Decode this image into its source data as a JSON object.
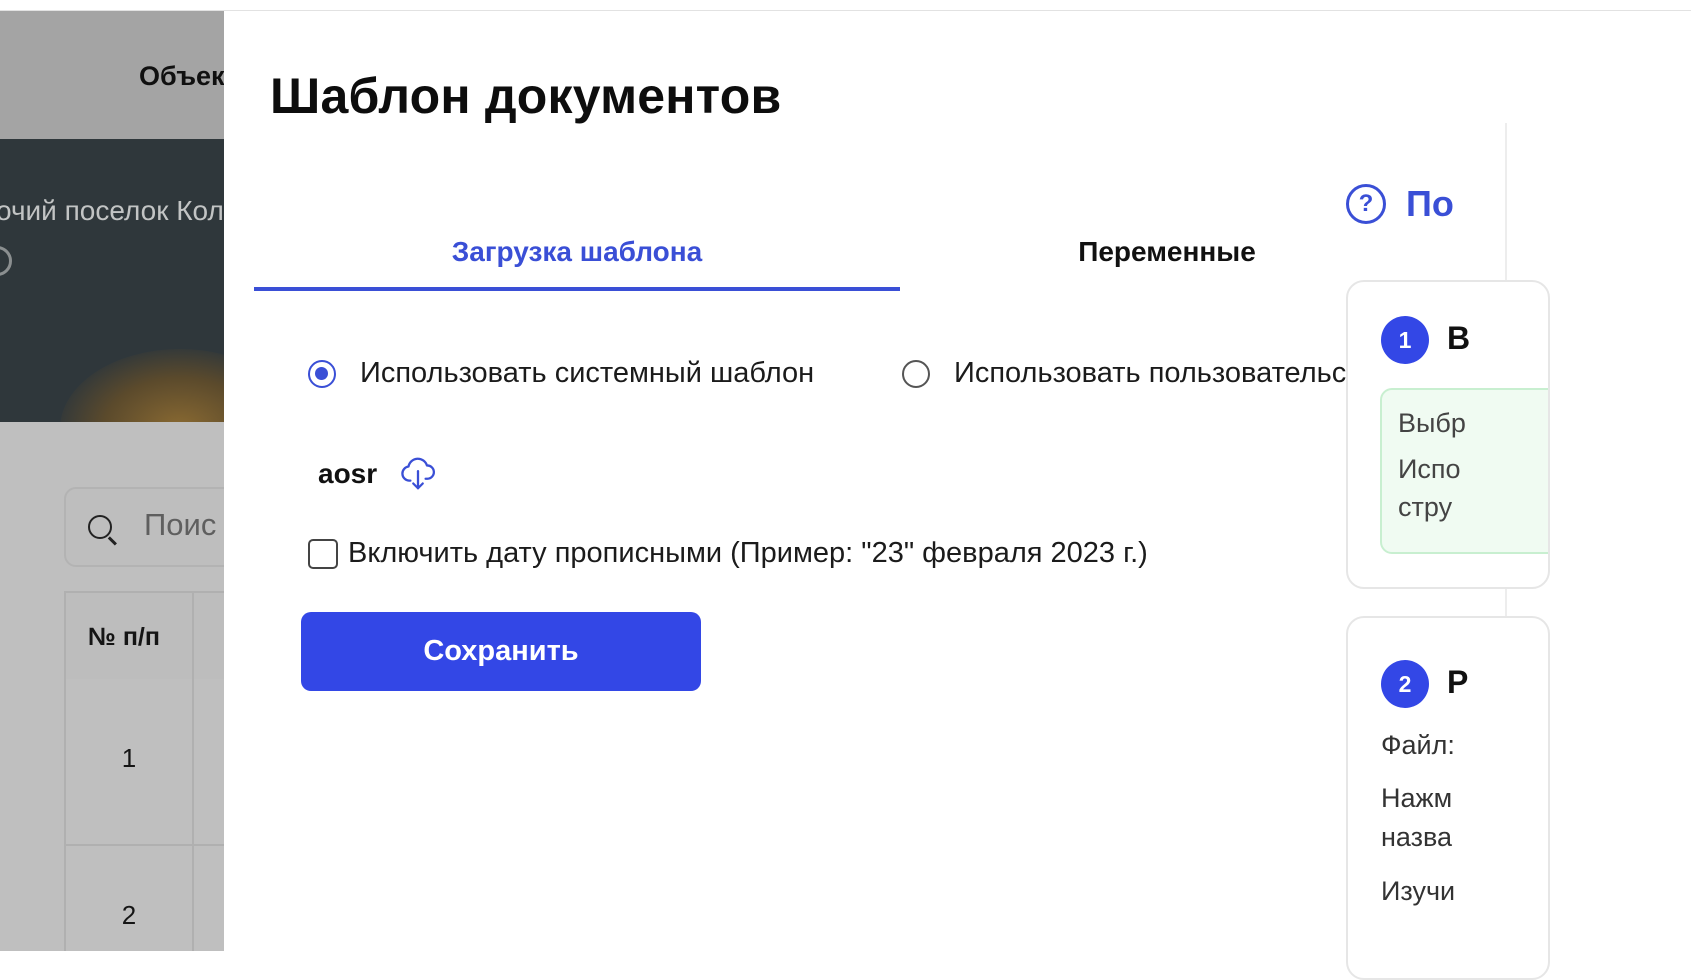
{
  "background": {
    "nav_item": "Объек",
    "banner_text": "очий поселок Кол",
    "search_placeholder": "Поис",
    "table": {
      "header": "№ п/п",
      "rows": [
        "1",
        "2"
      ]
    }
  },
  "modal": {
    "title": "Шаблон документов",
    "tabs": [
      {
        "label": "Загрузка шаблона",
        "active": true
      },
      {
        "label": "Переменные",
        "active": false
      }
    ],
    "template_options": [
      {
        "label": "Использовать системный шаблон",
        "selected": true
      },
      {
        "label": "Использовать пользовательский",
        "selected": false
      }
    ],
    "file": {
      "name": "aosr",
      "icon": "cloud-download-icon"
    },
    "date_checkbox": {
      "label": "Включить дату прописными (Пример: \"23\" февраля 2023 г.)",
      "checked": false
    },
    "save_label": "Сохранить"
  },
  "help": {
    "icon_glyph": "?",
    "title": "По",
    "steps": [
      {
        "number": "1",
        "title": "В",
        "note_lines": [
          "Выбр",
          "Испо",
          "стру"
        ]
      },
      {
        "number": "2",
        "title": "Р",
        "lines": [
          "Файл:",
          "Нажм",
          "назва",
          "Изучи"
        ]
      }
    ]
  },
  "colors": {
    "accent": "#3a4fd6",
    "button": "#3347e6",
    "note_bg": "#f0fbf2",
    "overlay": "#bfbfbf"
  }
}
